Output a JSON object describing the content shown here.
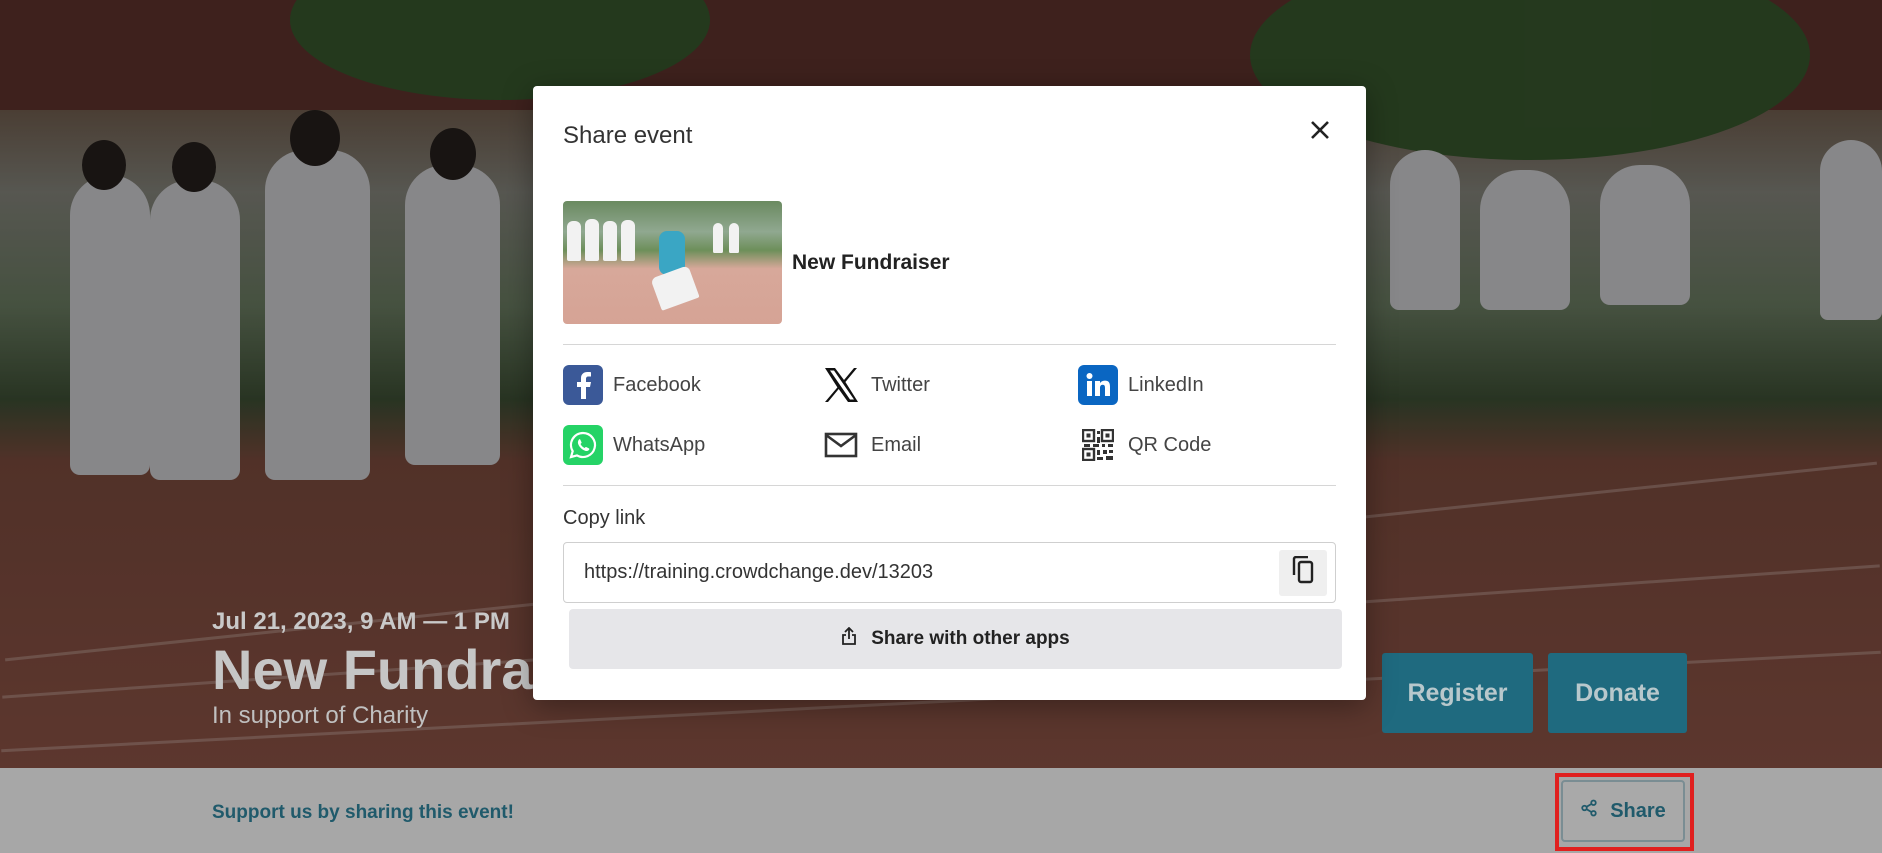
{
  "event": {
    "date": "Jul 21, 2023, 9 AM — 1 PM",
    "title": "New Fundraiser",
    "subtitle": "In support of Charity",
    "register_label": "Register",
    "donate_label": "Donate"
  },
  "share_bar": {
    "text": "Support us by sharing this event!",
    "share_label": "Share"
  },
  "modal": {
    "title": "Share event",
    "preview_title": "New Fundraiser",
    "social": [
      {
        "label": "Facebook",
        "icon": "facebook-icon",
        "color": "#3b5998"
      },
      {
        "label": "Twitter",
        "icon": "x-twitter-icon",
        "color": "#000000"
      },
      {
        "label": "LinkedIn",
        "icon": "linkedin-icon",
        "color": "#0a66c2"
      },
      {
        "label": "WhatsApp",
        "icon": "whatsapp-icon",
        "color": "#25d366"
      },
      {
        "label": "Email",
        "icon": "envelope-icon",
        "color": "#333333"
      },
      {
        "label": "QR Code",
        "icon": "qr-code-icon",
        "color": "#333333"
      }
    ],
    "copy_label": "Copy link",
    "link": "https://training.crowdchange.dev/13203",
    "share_apps_label": "Share with other apps"
  },
  "colors": {
    "accent": "#1f6a7f",
    "highlight": "#e0201f"
  }
}
